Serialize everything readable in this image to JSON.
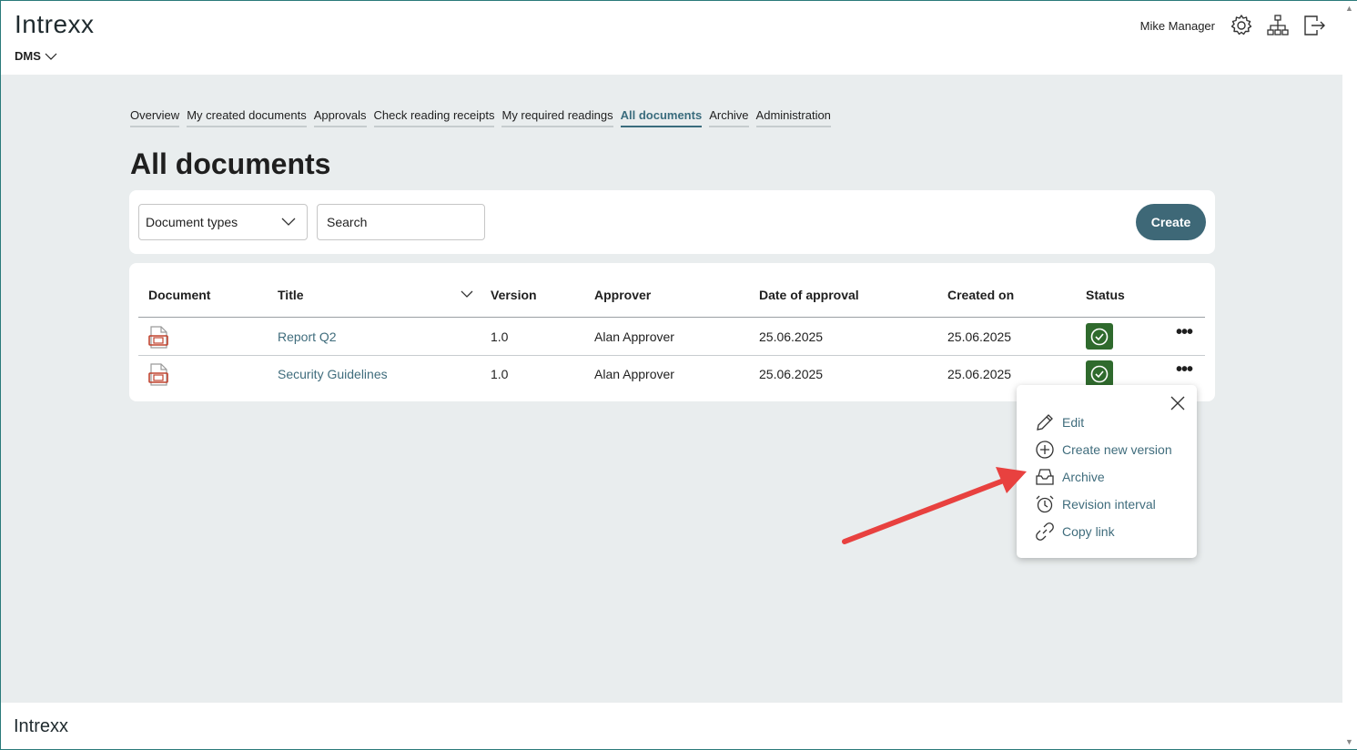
{
  "header": {
    "logo": "Intrexx",
    "app_name": "DMS",
    "user_name": "Mike Manager",
    "icons": [
      "gear-icon",
      "sitemap-icon",
      "logout-icon"
    ]
  },
  "tabs": [
    {
      "label": "Overview",
      "active": false
    },
    {
      "label": "My created documents",
      "active": false
    },
    {
      "label": "Approvals",
      "active": false
    },
    {
      "label": "Check reading receipts",
      "active": false
    },
    {
      "label": "My required readings",
      "active": false
    },
    {
      "label": "All documents",
      "active": true
    },
    {
      "label": "Archive",
      "active": false
    },
    {
      "label": "Administration",
      "active": false
    }
  ],
  "page_title": "All documents",
  "filters": {
    "document_types_label": "Document types",
    "search_placeholder": "Search",
    "create_label": "Create"
  },
  "table": {
    "columns": [
      "Document",
      "Title",
      "Version",
      "Approver",
      "Date of approval",
      "Created on",
      "Status"
    ],
    "rows": [
      {
        "title": "Report Q2",
        "version": "1.0",
        "approver": "Alan Approver",
        "date_of_approval": "25.06.2025",
        "created_on": "25.06.2025",
        "status": "approved"
      },
      {
        "title": "Security Guidelines",
        "version": "1.0",
        "approver": "Alan Approver",
        "date_of_approval": "25.06.2025",
        "created_on": "25.06.2025",
        "status": "approved"
      }
    ]
  },
  "context_menu": {
    "items": [
      {
        "label": "Edit",
        "icon": "pencil-icon"
      },
      {
        "label": "Create new version",
        "icon": "plus-circle-icon"
      },
      {
        "label": "Archive",
        "icon": "archive-icon"
      },
      {
        "label": "Revision interval",
        "icon": "alarm-clock-icon"
      },
      {
        "label": "Copy link",
        "icon": "link-icon"
      }
    ]
  },
  "colors": {
    "accent": "#3e6877",
    "link": "#3f6c7c",
    "status_ok": "#2f6a2d",
    "background": "#e9edee",
    "annotation_arrow": "#e8413f"
  },
  "footer": {
    "logo": "Intrexx"
  }
}
